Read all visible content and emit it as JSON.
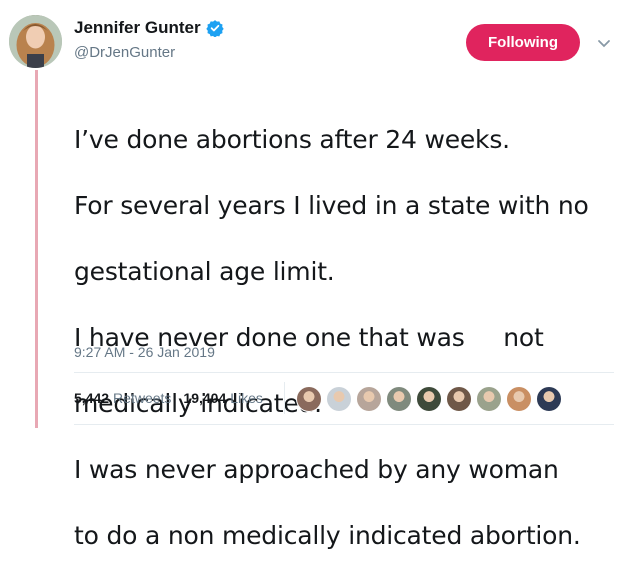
{
  "author": {
    "display_name": "Jennifer Gunter",
    "handle": "@DrJenGunter",
    "verified": true
  },
  "follow_button": {
    "label": "Following",
    "color": "#e0245e"
  },
  "tweet": {
    "lines": [
      "I’ve done abortions after 24 weeks.",
      "For several years I lived in a state with no",
      "gestational age limit.",
      "I have never done one that was     not",
      "medically indicated.",
      "I was never approached by any woman",
      "to do a non medically indicated abortion."
    ],
    "timestamp": "9:27 AM - 26 Jan 2019"
  },
  "stats": {
    "retweets_count": "5,442",
    "retweets_label": "Retweets",
    "likes_count": "19,404",
    "likes_label": "Likes"
  },
  "liker_faces": [
    {
      "color": "#8a6a5c"
    },
    {
      "color": "#c9d1d8"
    },
    {
      "color": "#b7a59a"
    },
    {
      "color": "#7f8a7d"
    },
    {
      "color": "#3e4a3a"
    },
    {
      "color": "#6f5848"
    },
    {
      "color": "#9aa28c"
    },
    {
      "color": "#c98f63"
    },
    {
      "color": "#2d3a55"
    }
  ],
  "colors": {
    "thread_line": "#e8a8b4",
    "verified_badge": "#1da1f2",
    "secondary_text": "#657786"
  }
}
